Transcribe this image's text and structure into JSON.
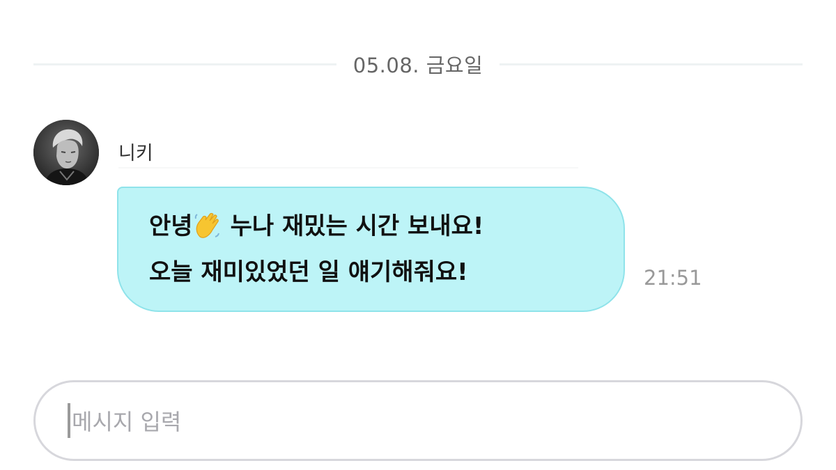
{
  "chat": {
    "date_label": "05.08. 금요일",
    "sender": {
      "name": "니키",
      "avatar_icon": "profile-photo"
    },
    "message": {
      "line1_part1": "안녕",
      "emoji": "waving-hand-icon",
      "line1_part2": "누나 재밌는 시간 보내요!",
      "line2": "오늘 재미있었던 일 얘기해줘요!",
      "time": "21:51",
      "bubble_color": "#bdf4f7",
      "bubble_border_color": "#8fe3ea"
    },
    "input": {
      "placeholder": "메시지 입력"
    }
  }
}
